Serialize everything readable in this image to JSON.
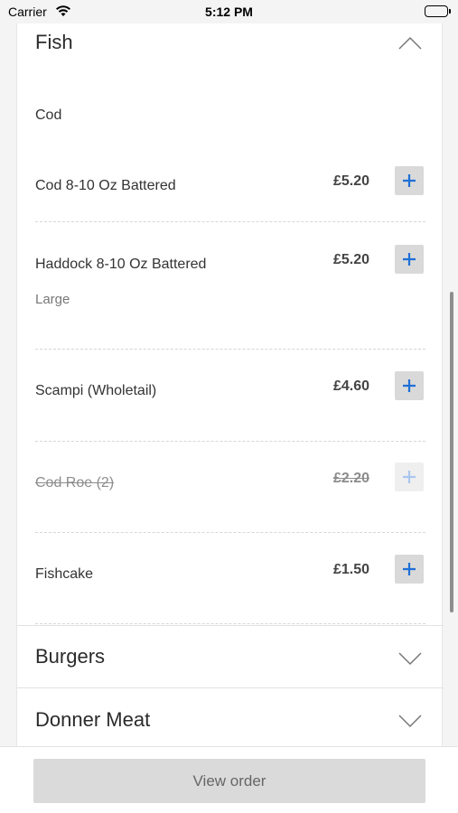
{
  "status_bar": {
    "carrier": "Carrier",
    "time": "5:12 PM"
  },
  "sections": [
    {
      "title": "Fish",
      "state": "expanded"
    },
    {
      "title": "Burgers",
      "state": "collapsed"
    },
    {
      "title": "Donner Meat",
      "state": "collapsed"
    }
  ],
  "fish": {
    "sub_heading": "Cod",
    "items": [
      {
        "name": "Cod 8-10 Oz Battered",
        "price": "£5.20",
        "description": "",
        "available": true
      },
      {
        "name": "Haddock 8-10 Oz Battered",
        "price": "£5.20",
        "description": "Large",
        "available": true
      },
      {
        "name": "Scampi (Wholetail)",
        "price": "£4.60",
        "description": "",
        "available": true
      },
      {
        "name": "Cod Roe (2)",
        "price": "£2.20",
        "description": "",
        "available": false
      },
      {
        "name": "Fishcake",
        "price": "£1.50",
        "description": "",
        "available": true
      }
    ]
  },
  "footer": {
    "view_order_label": "View order"
  },
  "colors": {
    "accent": "#1f6fd6",
    "button_bg": "#dadada"
  }
}
